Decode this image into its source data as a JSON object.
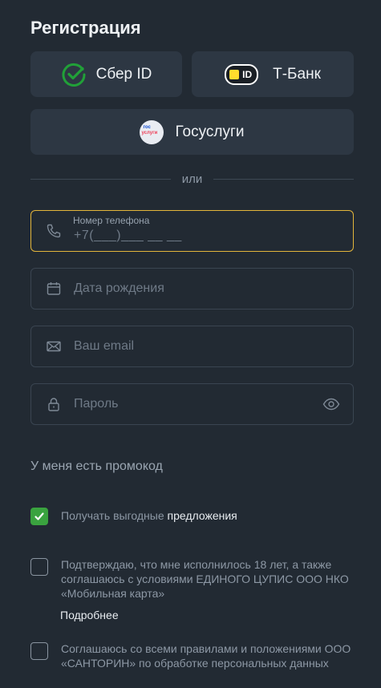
{
  "page": {
    "title": "Регистрация"
  },
  "auth": {
    "sber_label": "Сбер ID",
    "tbank_badge": "ID",
    "tbank_label": "Т-Банк",
    "gos_logo_top": "гос",
    "gos_logo_bottom": "услуги",
    "gos_label": "Госуслуги"
  },
  "divider": {
    "text": "или"
  },
  "form": {
    "phone_label": "Номер телефона",
    "phone_mask": "+7(___)___ __ __",
    "birthdate_placeholder": "Дата рождения",
    "email_placeholder": "Ваш email",
    "password_placeholder": "Пароль"
  },
  "promo": {
    "label": "У меня есть промокод"
  },
  "consents": {
    "offers_prefix": "Получать выгодные ",
    "offers_highlight": "предложения",
    "offers_checked": true,
    "age_text": "Подтверждаю, что мне исполнилось 18 лет, а также соглашаюсь с условиями ЕДИНОГО ЦУПИС ООО НКО «Мобильная карта»",
    "age_checked": false,
    "more_link": "Подробнее",
    "rules_text": "Соглашаюсь со всеми правилами и положениями ООО «САНТОРИН» по обработке персональных данных",
    "rules_checked": false
  },
  "colors": {
    "background": "#222a33",
    "button_bg": "#2d3743",
    "active_border": "#e3b53b",
    "checkbox_on": "#3aa33f",
    "sber_green": "#21a038",
    "tbank_yellow": "#ffdd2d"
  },
  "icons": [
    "sber-logo-icon",
    "tbank-logo-icon",
    "gosuslugi-logo-icon",
    "phone-icon",
    "calendar-icon",
    "mail-icon",
    "lock-icon",
    "eye-icon",
    "checkmark-icon"
  ]
}
